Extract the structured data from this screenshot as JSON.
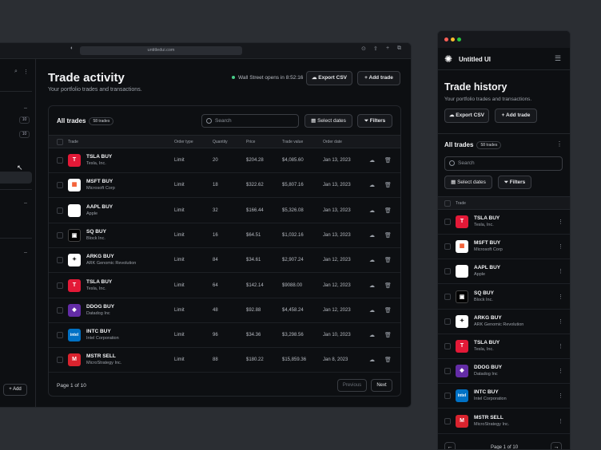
{
  "browser": {
    "url": "untitledui.com"
  },
  "sidebar": {
    "badges": [
      "10",
      "10"
    ],
    "add_label": "Add"
  },
  "page": {
    "title": "Trade activity",
    "subtitle": "Your portfolio trades and transactions.",
    "market_status": "Wall Street opens in 8:52:16",
    "export_label": "Export CSV",
    "add_label": "Add trade"
  },
  "table": {
    "title": "All trades",
    "count_badge": "58 trades",
    "search_placeholder": "Search",
    "dates_label": "Select dates",
    "filters_label": "Filters",
    "headers": [
      "Trade",
      "Order type",
      "Quantity",
      "Price",
      "Trade value",
      "Order date"
    ],
    "rows": [
      {
        "trade": "TSLA BUY",
        "company": "Tesla, Inc.",
        "type": "Limit",
        "qty": "20",
        "price": "$204.28",
        "value": "$4,085.60",
        "date": "Jan 13, 2023",
        "logo": "tesla-logo",
        "color": "#e31937"
      },
      {
        "trade": "MSFT BUY",
        "company": "Microsoft Corp",
        "type": "Limit",
        "qty": "18",
        "price": "$322.62",
        "value": "$5,807.16",
        "date": "Jan 13, 2023",
        "logo": "microsoft-logo",
        "color": "#ffffff"
      },
      {
        "trade": "AAPL BUY",
        "company": "Apple",
        "type": "Limit",
        "qty": "32",
        "price": "$166.44",
        "value": "$5,326.08",
        "date": "Jan 13, 2023",
        "logo": "apple-logo",
        "color": "#ffffff"
      },
      {
        "trade": "SQ BUY",
        "company": "Block Inc.",
        "type": "Limit",
        "qty": "16",
        "price": "$64.51",
        "value": "$1,032.16",
        "date": "Jan 13, 2023",
        "logo": "block-logo",
        "color": "#000000"
      },
      {
        "trade": "ARKG BUY",
        "company": "ARK Genomic Revolution",
        "type": "Limit",
        "qty": "84",
        "price": "$34.61",
        "value": "$2,907.24",
        "date": "Jan 12, 2023",
        "logo": "ark-logo",
        "color": "#ffffff"
      },
      {
        "trade": "TSLA BUY",
        "company": "Tesla, Inc.",
        "type": "Limit",
        "qty": "64",
        "price": "$142.14",
        "value": "$9088.00",
        "date": "Jan 12, 2023",
        "logo": "tesla-logo",
        "color": "#e31937"
      },
      {
        "trade": "DDOG BUY",
        "company": "Datadog Inc",
        "type": "Limit",
        "qty": "48",
        "price": "$92.88",
        "value": "$4,458.24",
        "date": "Jan 12, 2023",
        "logo": "datadog-logo",
        "color": "#632ca6"
      },
      {
        "trade": "INTC BUY",
        "company": "Intel Corporation",
        "type": "Limit",
        "qty": "96",
        "price": "$34.36",
        "value": "$3,298.56",
        "date": "Jan 10, 2023",
        "logo": "intel-logo",
        "color": "#0071c5"
      },
      {
        "trade": "MSTR SELL",
        "company": "MicroStrategy Inc.",
        "type": "Limit",
        "qty": "88",
        "price": "$180.22",
        "value": "$15,859.36",
        "date": "Jan 8, 2023",
        "logo": "microstrategy-logo",
        "color": "#d9232e"
      }
    ],
    "pagination": {
      "label": "Page 1 of 10",
      "prev": "Previous",
      "next": "Next"
    }
  },
  "mobile": {
    "app_name": "Untitled UI",
    "title": "Trade history",
    "subtitle": "Your portfolio trades and transactions.",
    "export_label": "Export CSV",
    "add_label": "Add trade",
    "table_title": "All trades",
    "count_badge": "58 trades",
    "search_placeholder": "Search",
    "dates_label": "Select dates",
    "filters_label": "Filters",
    "header": "Trade",
    "pagination": "Page 1 of 10"
  }
}
